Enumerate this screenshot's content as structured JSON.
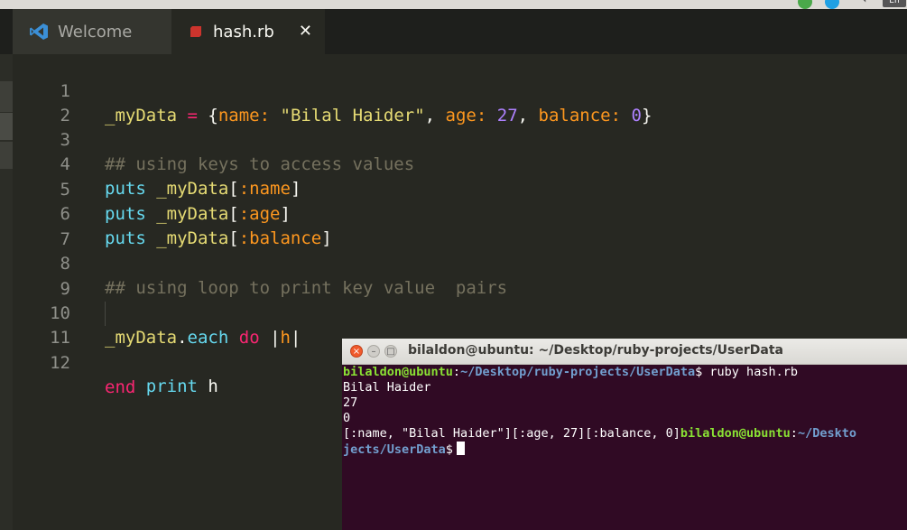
{
  "system_tray": {
    "icons": [
      "vpn-icon",
      "skype-icon",
      "wifi-icon"
    ],
    "language": "En"
  },
  "tabs": [
    {
      "label": "Welcome",
      "icon": "vscode-icon",
      "active": false
    },
    {
      "label": "hash.rb",
      "icon": "ruby-file-icon",
      "active": true,
      "close": "✕"
    }
  ],
  "editor": {
    "line_numbers": [
      "1",
      "2",
      "3",
      "4",
      "5",
      "6",
      "7",
      "8",
      "9",
      "10",
      "11",
      "12"
    ],
    "lines": {
      "l1": {
        "var": "_myData",
        "eq": " = ",
        "open": "{",
        "k1": "name:",
        "s1": " \"Bilal Haider\"",
        "c1": ", ",
        "k2": "age:",
        "n2": " 27",
        "c2": ", ",
        "k3": "balance:",
        "n3": " 0",
        "close": "}"
      },
      "l3": {
        "comment": "## using keys to access values"
      },
      "l4": {
        "fn": "puts",
        "var": " _myData",
        "open": "[",
        "sym": ":name",
        "close": "]"
      },
      "l5": {
        "fn": "puts",
        "var": " _myData",
        "open": "[",
        "sym": ":age",
        "close": "]"
      },
      "l6": {
        "fn": "puts",
        "var": " _myData",
        "open": "[",
        "sym": ":balance",
        "close": "]"
      },
      "l8": {
        "comment": "## using loop to print key value  pairs"
      },
      "l10": {
        "var": "_myData",
        "dot": ".",
        "method": "each",
        "sp": " ",
        "kw": "do",
        "bar_open": " |",
        "param": "h",
        "bar_close": "|"
      },
      "l11": {
        "indent": "    ",
        "fn": "print",
        "arg": " h"
      },
      "l12": {
        "kw": "end"
      }
    }
  },
  "terminal": {
    "title": "bilaldon@ubuntu: ~/Desktop/ruby-projects/UserData",
    "buttons": {
      "close": "×",
      "minimize": "–",
      "maximize": "□"
    },
    "prompt_user": "bilaldon@ubuntu",
    "prompt_sep": ":",
    "prompt_path": "~/Desktop/ruby-projects/UserData",
    "prompt_dollar": "$ ",
    "command": "ruby hash.rb",
    "output": [
      "Bilal Haider",
      "27",
      "0"
    ],
    "output_pairs": "[:name, \"Bilal Haider\"][:age, 27][:balance, 0]",
    "wrap_user": "bilaldon@ubuntu",
    "wrap_sep": ":",
    "wrap_path_a": "~/Deskto",
    "wrap_path_b": "jects/UserData",
    "wrap_dollar": "$"
  }
}
